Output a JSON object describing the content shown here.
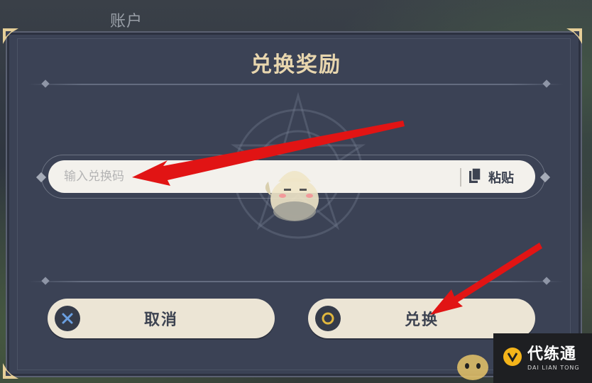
{
  "header": {
    "tab_label": "账户"
  },
  "dialog": {
    "title": "兑换奖励",
    "input": {
      "placeholder": "输入兑换码",
      "value": ""
    },
    "paste_label": "粘贴",
    "cancel": {
      "label": "取消",
      "badge_icon": "x-icon"
    },
    "confirm": {
      "label": "兑换",
      "badge_icon": "circle-icon"
    }
  },
  "watermark": {
    "brand": "代练通",
    "brand_sub": "DAI LIAN TONG"
  },
  "colors": {
    "dialog_bg": "#3b4255",
    "title": "#e8d6ae",
    "button_bg": "#ece5d5",
    "arrow": "#e11414",
    "accent_x": "#6a9fe0",
    "accent_o": "#e0b73e"
  }
}
